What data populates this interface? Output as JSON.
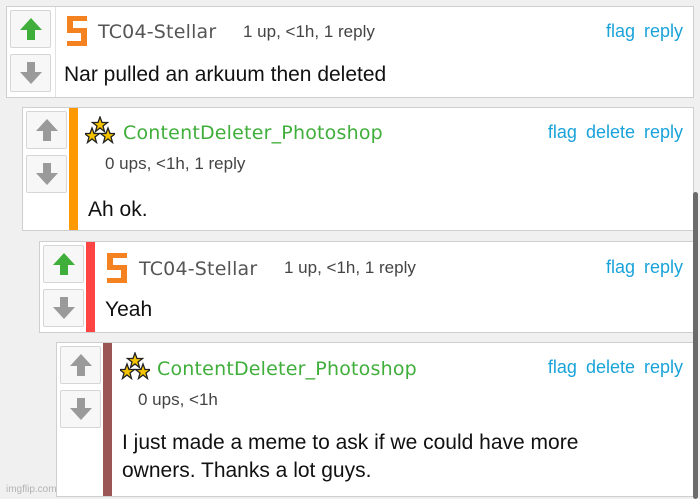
{
  "colors": {
    "accent_link": "#1aa3d9",
    "upvoted": "#3fae3a",
    "neutral_arrow": "#9a9a9a",
    "stripe_orange": "#ff9900",
    "stripe_red": "#ff4444",
    "stripe_maroon": "#9c5555"
  },
  "comments": [
    {
      "username": "TC04-Stellar",
      "meta": "1 up, <1h, 1 reply",
      "actions": {
        "flag": "flag",
        "reply": "reply"
      },
      "text": "Nar pulled an arkuum then deleted",
      "upvoted": true,
      "avatar": "imgflip-logo-icon"
    },
    {
      "username": "ContentDeleter_Photoshop",
      "meta": "0 ups, <1h, 1 reply",
      "actions": {
        "flag": "flag",
        "delete": "delete",
        "reply": "reply"
      },
      "text": "Ah ok.",
      "upvoted": false,
      "avatar": "stars-icon"
    },
    {
      "username": "TC04-Stellar",
      "meta": "1 up, <1h, 1 reply",
      "actions": {
        "flag": "flag",
        "reply": "reply"
      },
      "text": "Yeah",
      "upvoted": true,
      "avatar": "imgflip-logo-icon"
    },
    {
      "username": "ContentDeleter_Photoshop",
      "meta": "0 ups, <1h",
      "actions": {
        "flag": "flag",
        "delete": "delete",
        "reply": "reply"
      },
      "text_line1": "I just made a meme to ask if we could have more",
      "text_line2": "owners. Thanks a lot guys.",
      "upvoted": false,
      "avatar": "stars-icon"
    }
  ],
  "watermark": "imgflip.com"
}
